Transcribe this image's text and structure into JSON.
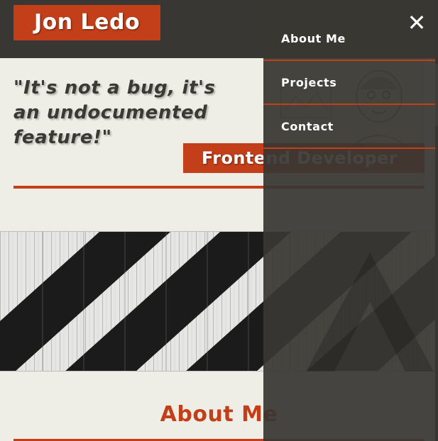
{
  "site": {
    "logo_text": "Jon Ledo"
  },
  "hero": {
    "quote": "\"It's not a bug, it's an undocumented feature!\"",
    "role": "Frontend Developer",
    "portrait_alt": "Portrait illustration"
  },
  "about": {
    "title": "About Me"
  },
  "nav_drawer": {
    "close_icon": "close-icon",
    "items": [
      {
        "label": "About Me"
      },
      {
        "label": "Projects"
      },
      {
        "label": "Contact"
      }
    ]
  },
  "colors": {
    "header_bg": "#383733",
    "accent": "#c23f19",
    "page_bg": "#efeee6",
    "drawer_bg": "#383733",
    "quote_text": "#3a3935"
  },
  "banner": {
    "description_icon": "striped-wood-image"
  }
}
